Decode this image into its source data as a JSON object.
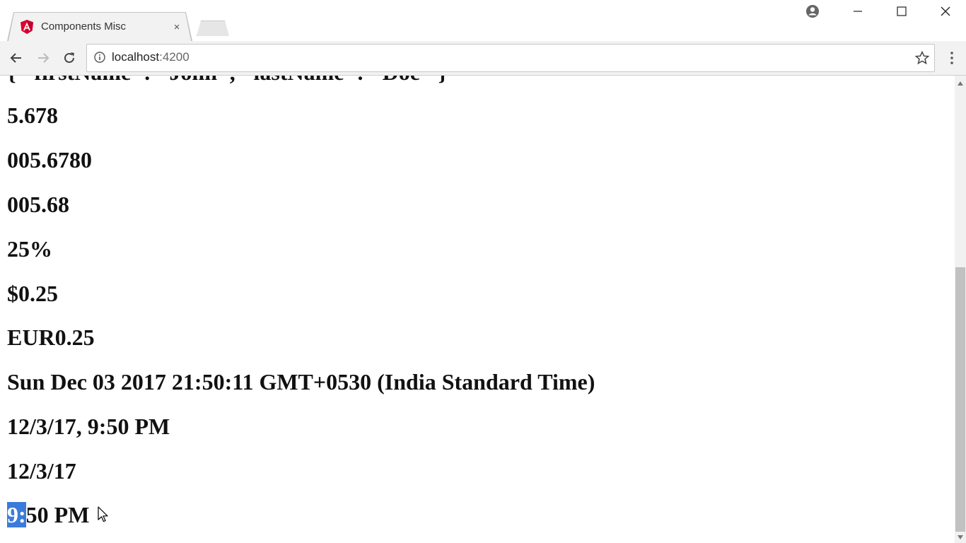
{
  "browser": {
    "tab_title": "Components Misc",
    "tab_close": "×",
    "url_host": "localhost",
    "url_port": ":4200",
    "icons": {
      "favicon": "angular-logo-icon",
      "profile": "profile-icon",
      "minimize": "minimize-icon",
      "maximize": "maximize-icon",
      "close": "close-icon",
      "back": "back-arrow-icon",
      "forward": "forward-arrow-icon",
      "reload": "reload-icon",
      "info": "info-icon",
      "star": "star-icon",
      "menu": "kebab-menu-icon"
    },
    "accent": "#dd0031"
  },
  "page": {
    "lines": [
      "{ \"firstName\": \"John\", \"lastName\": \"Doe\" }",
      "5.678",
      "005.6780",
      "005.68",
      "25%",
      "$0.25",
      "EUR0.25",
      "Sun Dec 03 2017 21:50:11 GMT+0530 (India Standard Time)",
      "12/3/17, 9:50 PM",
      "12/3/17"
    ],
    "last_line_selected": "9:",
    "last_line_rest": "50 PM",
    "selection_color": "#3b7bdc"
  }
}
